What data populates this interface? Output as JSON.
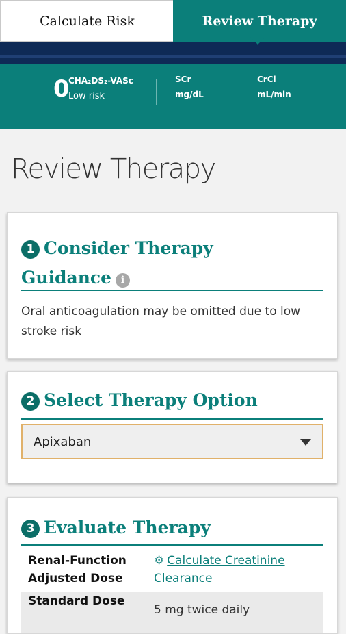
{
  "tabs": {
    "calculate_risk": "Calculate Risk",
    "review_therapy": "Review Therapy"
  },
  "stats": {
    "score": "0",
    "score_label": "CHA₂DS₂-VASc",
    "risk": "Low risk",
    "scr_label": "SCr",
    "scr_unit": "mg/dL",
    "crcl_label": "CrCl",
    "crcl_unit": "mL/min"
  },
  "page": {
    "title": "Review Therapy"
  },
  "step1": {
    "number": "1",
    "title_line1": "Consider Therapy",
    "title_line2": "Guidance",
    "info_glyph": "i",
    "text": "Oral anticoagulation may be omitted due to low stroke risk"
  },
  "step2": {
    "number": "2",
    "title": "Select Therapy Option",
    "selected": "Apixaban"
  },
  "step3": {
    "number": "3",
    "title": "Evaluate Therapy",
    "rows": [
      {
        "label_line1": "Renal-Function",
        "label_line2": "Adjusted Dose",
        "icon": "gear-icon",
        "link_line1": "Calculate Creatinine",
        "link_line2": "Clearance"
      },
      {
        "label_line1": "Standard Dose",
        "value": "5 mg twice daily"
      }
    ]
  },
  "colors": {
    "teal": "#0b7f7a",
    "navy": "#0e2a56",
    "select_border": "#e0b16a"
  }
}
